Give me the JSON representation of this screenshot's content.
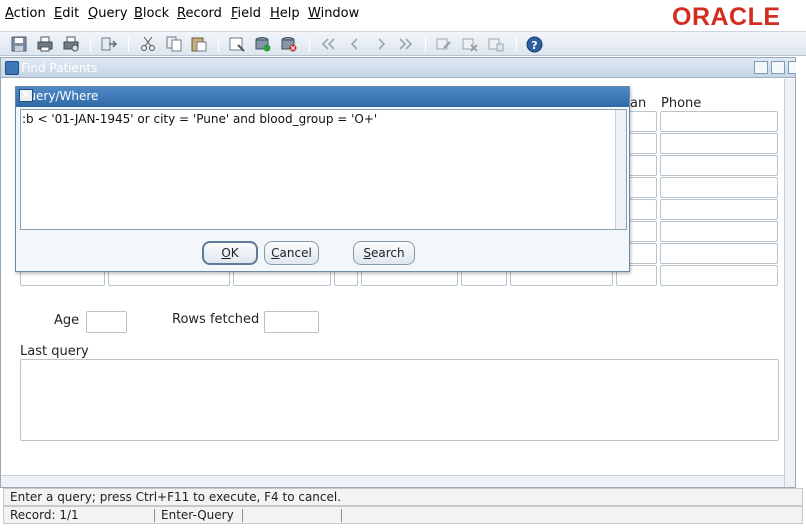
{
  "menubar": {
    "items": [
      {
        "key": "A",
        "rest": "ction"
      },
      {
        "key": "E",
        "rest": "dit"
      },
      {
        "key": "Q",
        "rest": "uery"
      },
      {
        "key": "B",
        "rest": "lock"
      },
      {
        "key": "R",
        "rest": "ecord"
      },
      {
        "key": "F",
        "rest": "ield"
      },
      {
        "key": "H",
        "rest": "elp"
      },
      {
        "key": "W",
        "rest": "indow"
      }
    ],
    "logo": "ORACLE"
  },
  "toolbar": {
    "icons": [
      "save-icon",
      "print-icon",
      "print-setup-icon",
      "exit-icon",
      "cut-icon",
      "copy-icon",
      "paste-icon",
      "clear-icon",
      "insert-record-icon",
      "delete-record-icon",
      "first-record-icon",
      "previous-record-icon",
      "next-record-icon",
      "last-record-icon",
      "edit-icon",
      "query-icon",
      "list-icon",
      "help-icon"
    ],
    "accent": "#2d5ea1"
  },
  "window": {
    "title": "Find Patients",
    "columns": {
      "partial_label": "an",
      "phone_label": "Phone"
    },
    "age_label": "Age",
    "rows_fetched_label": "Rows fetched",
    "last_query_label": "Last query"
  },
  "dialog": {
    "title": "Query/Where",
    "query_text": ":b < '01-JAN-1945' or city = 'Pune' and blood_group = 'O+'",
    "buttons": {
      "ok": {
        "key": "O",
        "rest": "K"
      },
      "cancel": {
        "key": "C",
        "rest": "ancel"
      },
      "search": {
        "key": "S",
        "rest": "earch"
      }
    }
  },
  "status": {
    "message": "Enter a query;  press Ctrl+F11 to execute, F4 to cancel.",
    "record": "Record: 1/1",
    "mode": "Enter-Query"
  }
}
